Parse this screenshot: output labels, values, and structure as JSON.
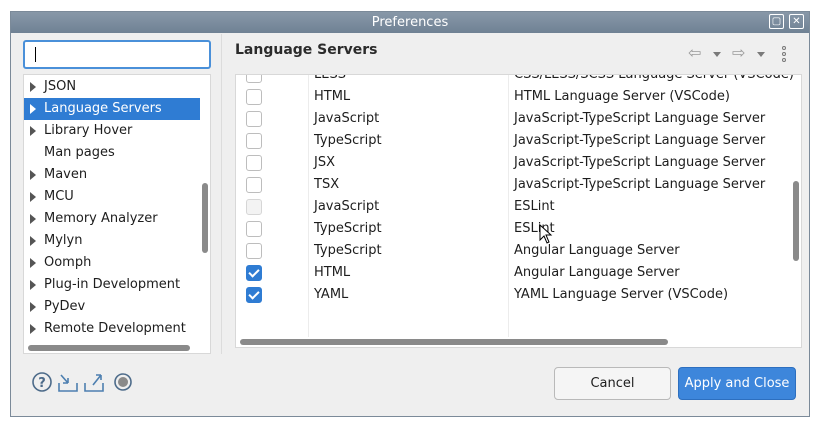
{
  "window": {
    "title": "Preferences"
  },
  "search": {
    "value": "",
    "placeholder": ""
  },
  "tree": {
    "items": [
      {
        "label": "JSON",
        "expandable": true,
        "selected": false
      },
      {
        "label": "Language Servers",
        "expandable": true,
        "selected": true
      },
      {
        "label": "Library Hover",
        "expandable": true,
        "selected": false
      },
      {
        "label": "Man pages",
        "expandable": false,
        "selected": false
      },
      {
        "label": "Maven",
        "expandable": true,
        "selected": false
      },
      {
        "label": "MCU",
        "expandable": true,
        "selected": false
      },
      {
        "label": "Memory Analyzer",
        "expandable": true,
        "selected": false
      },
      {
        "label": "Mylyn",
        "expandable": true,
        "selected": false
      },
      {
        "label": "Oomph",
        "expandable": true,
        "selected": false
      },
      {
        "label": "Plug-in Development",
        "expandable": true,
        "selected": false
      },
      {
        "label": "PyDev",
        "expandable": true,
        "selected": false
      },
      {
        "label": "Remote Development",
        "expandable": true,
        "selected": false
      }
    ]
  },
  "page": {
    "title": "Language Servers"
  },
  "table": {
    "rows": [
      {
        "checked": false,
        "disabled": false,
        "content_type": "LESS",
        "server": "CSS/LESS/SCSS Language Server (VSCode)"
      },
      {
        "checked": false,
        "disabled": false,
        "content_type": "HTML",
        "server": "HTML Language Server (VSCode)"
      },
      {
        "checked": false,
        "disabled": false,
        "content_type": "JavaScript",
        "server": "JavaScript-TypeScript Language Server"
      },
      {
        "checked": false,
        "disabled": false,
        "content_type": "TypeScript",
        "server": "JavaScript-TypeScript Language Server"
      },
      {
        "checked": false,
        "disabled": false,
        "content_type": "JSX",
        "server": "JavaScript-TypeScript Language Server"
      },
      {
        "checked": false,
        "disabled": false,
        "content_type": "TSX",
        "server": "JavaScript-TypeScript Language Server"
      },
      {
        "checked": false,
        "disabled": true,
        "content_type": "JavaScript",
        "server": "ESLint"
      },
      {
        "checked": false,
        "disabled": false,
        "content_type": "TypeScript",
        "server": "ESLint"
      },
      {
        "checked": false,
        "disabled": false,
        "content_type": "TypeScript",
        "server": "Angular Language Server"
      },
      {
        "checked": true,
        "disabled": false,
        "content_type": "HTML",
        "server": "Angular Language Server"
      },
      {
        "checked": true,
        "disabled": false,
        "content_type": "YAML",
        "server": "YAML Language Server (VSCode)"
      }
    ]
  },
  "buttons": {
    "cancel": "Cancel",
    "apply_close": "Apply and Close"
  },
  "colors": {
    "accent": "#2f7cd3",
    "titlebar": "#7b8ea1"
  }
}
